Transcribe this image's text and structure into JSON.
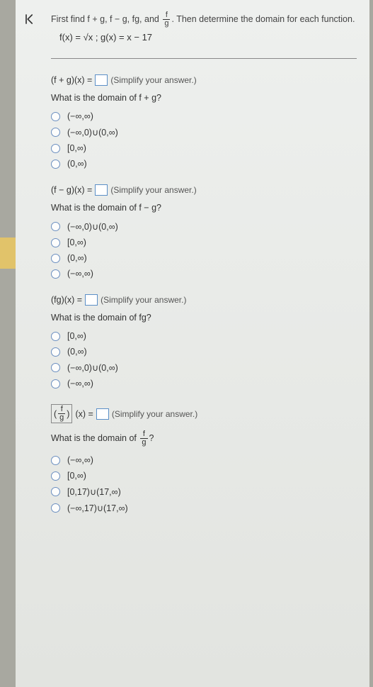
{
  "prompt_pre": "First find f + g, f − g, fg, and ",
  "prompt_post": ". Then determine the domain for each function.",
  "frac_f": "f",
  "frac_g": "g",
  "func_def": "f(x) = √x ; g(x) = x − 17",
  "q1": {
    "lhs": "(f + g)(x) =",
    "instr": "(Simplify your answer.)",
    "subhead": "What is the domain of f + g?",
    "opts": [
      "(−∞,∞)",
      "(−∞,0)∪(0,∞)",
      "[0,∞)",
      "(0,∞)"
    ]
  },
  "q2": {
    "lhs": "(f − g)(x) =",
    "instr": "(Simplify your answer.)",
    "subhead": "What is the domain of f − g?",
    "opts": [
      "(−∞,0)∪(0,∞)",
      "[0,∞)",
      "(0,∞)",
      "(−∞,∞)"
    ]
  },
  "q3": {
    "lhs": "(fg)(x) =",
    "instr": "(Simplify your answer.)",
    "subhead": "What is the domain of fg?",
    "opts": [
      "[0,∞)",
      "(0,∞)",
      "(−∞,0)∪(0,∞)",
      "(−∞,∞)"
    ]
  },
  "q4": {
    "rhs": "(x) =",
    "instr": "(Simplify your answer.)",
    "subhead_pre": "What is the domain of ",
    "subhead_post": "?",
    "opts": [
      "(−∞,∞)",
      "[0,∞)",
      "[0,17)∪(17,∞)",
      "(−∞,17)∪(17,∞)"
    ]
  }
}
